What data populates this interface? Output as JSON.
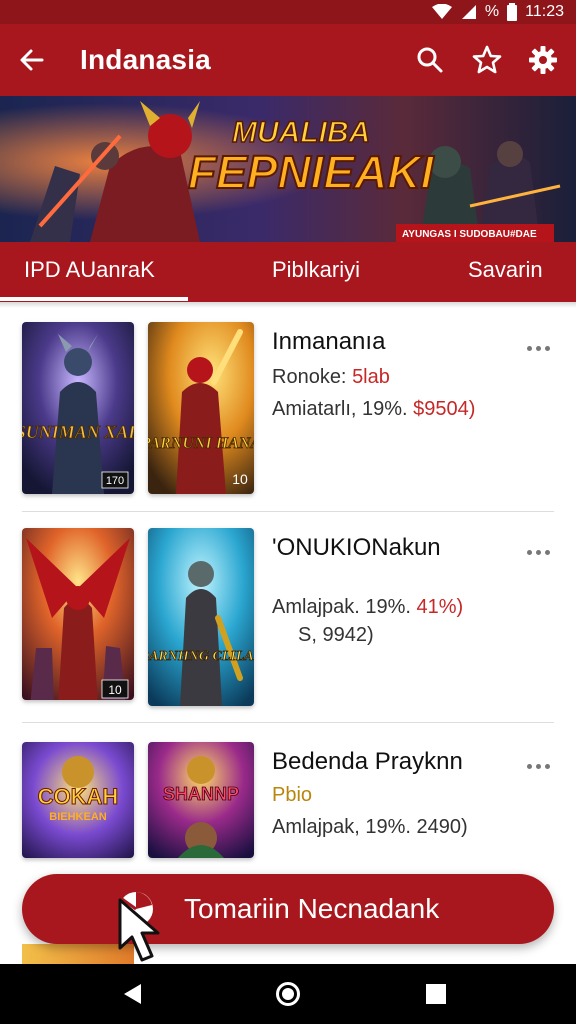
{
  "status_bar": {
    "percent": "%",
    "time": "11:23"
  },
  "app_bar": {
    "title": "Indanasia",
    "back_icon": "arrow-left-icon",
    "actions": [
      "search-icon",
      "star-icon",
      "gear-icon"
    ]
  },
  "banner": {
    "title_line1": "MUALIBA",
    "title_line2": "FEPNIEAKI",
    "tag": "AYUNGAS I SUDOBAU#DAE"
  },
  "tabs": [
    {
      "label": "IPD AUanraK",
      "active": true
    },
    {
      "label": "Piblkariyi",
      "active": false
    },
    {
      "label": "Savarin",
      "active": false
    }
  ],
  "items": [
    {
      "title": "Inmananıa",
      "line1_prefix": "Ronoke: ",
      "line1_price": "5lab",
      "line2_prefix": "Amiatarlı, 19%. ",
      "line2_price": "$9504)",
      "line3": "",
      "covers": [
        {
          "label": "SUNIMAN XAK",
          "badge": "170"
        },
        {
          "label": "PARNUNI HANA",
          "badge": "10"
        }
      ]
    },
    {
      "title": "'ONUKIONakun",
      "line1_prefix": "",
      "line1_price": "",
      "line2_prefix": "Amlajpak. 19%. ",
      "line2_price": "41%)",
      "line3": "S, 9942)",
      "covers": [
        {
          "label": "",
          "badge": "10"
        },
        {
          "label": "DARNHNG CLILAE",
          "badge": ""
        }
      ]
    },
    {
      "title": "Bedenda Prayknn",
      "line1_prefix": "Pbio",
      "line1_price": "",
      "line2_prefix": "Amlajpak, 19%. 2490)",
      "line2_price": "",
      "line3": "",
      "covers": [
        {
          "label": "COKAH",
          "sublabel": "BIEHKEAN",
          "badge": ""
        },
        {
          "label": "SHANNP",
          "badge": ""
        }
      ]
    }
  ],
  "fab": {
    "label": "Tomariin Necnadank",
    "icon": "pie-chart-icon"
  },
  "nav": [
    "back-triangle-icon",
    "home-circle-icon",
    "recents-square-icon"
  ],
  "colors": {
    "primary": "#a8171d",
    "primary_dark": "#8e1519",
    "price": "#c62828",
    "pbio": "#b8860b"
  }
}
